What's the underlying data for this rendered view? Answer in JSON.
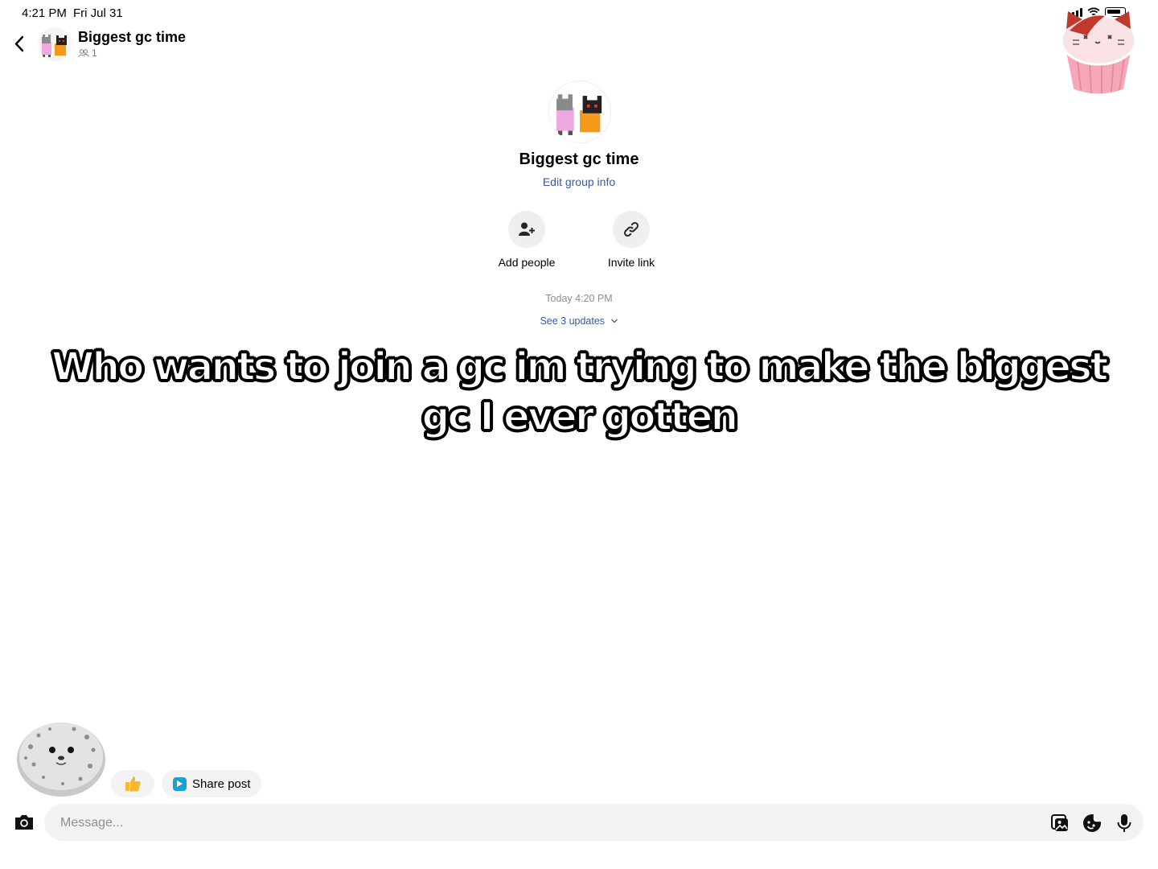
{
  "status_bar": {
    "time": "4:21 PM",
    "date": "Fri Jul 31",
    "icons": [
      "cellular-signal-icon",
      "wifi-icon",
      "battery-icon"
    ]
  },
  "header": {
    "title": "Biggest gc time",
    "member_count": "1",
    "icons": [
      "back-chevron-icon",
      "group-avatar",
      "people-icon"
    ]
  },
  "group_profile": {
    "title": "Biggest gc time",
    "edit_link": "Edit group info"
  },
  "actions": [
    {
      "label": "Add people",
      "icon": "add-person-icon"
    },
    {
      "label": "Invite link",
      "icon": "link-icon"
    }
  ],
  "thread": {
    "timestamp": "Today 4:20 PM",
    "updates_link": "See 3 updates"
  },
  "overlay_caption": "Who wants to join a gc im trying to make the biggest gc I ever gotten",
  "stickers": [
    "cat-cupcake-sticker",
    "seal-plush-sticker"
  ],
  "quick_actions": {
    "thumbs_icon": "thumbs-up-icon",
    "share_label": "Share post"
  },
  "composer": {
    "placeholder": "Message...",
    "icons": [
      "camera-icon",
      "gallery-icon",
      "sticker-icon",
      "microphone-icon"
    ]
  },
  "colors": {
    "link_blue": "#3a5ba0",
    "muted_gray": "#8e8e8e",
    "pill_bg": "#f3f3f3",
    "share_icon_blue": "#1aa1d6",
    "thumb_yellow": "#f5b82e"
  }
}
